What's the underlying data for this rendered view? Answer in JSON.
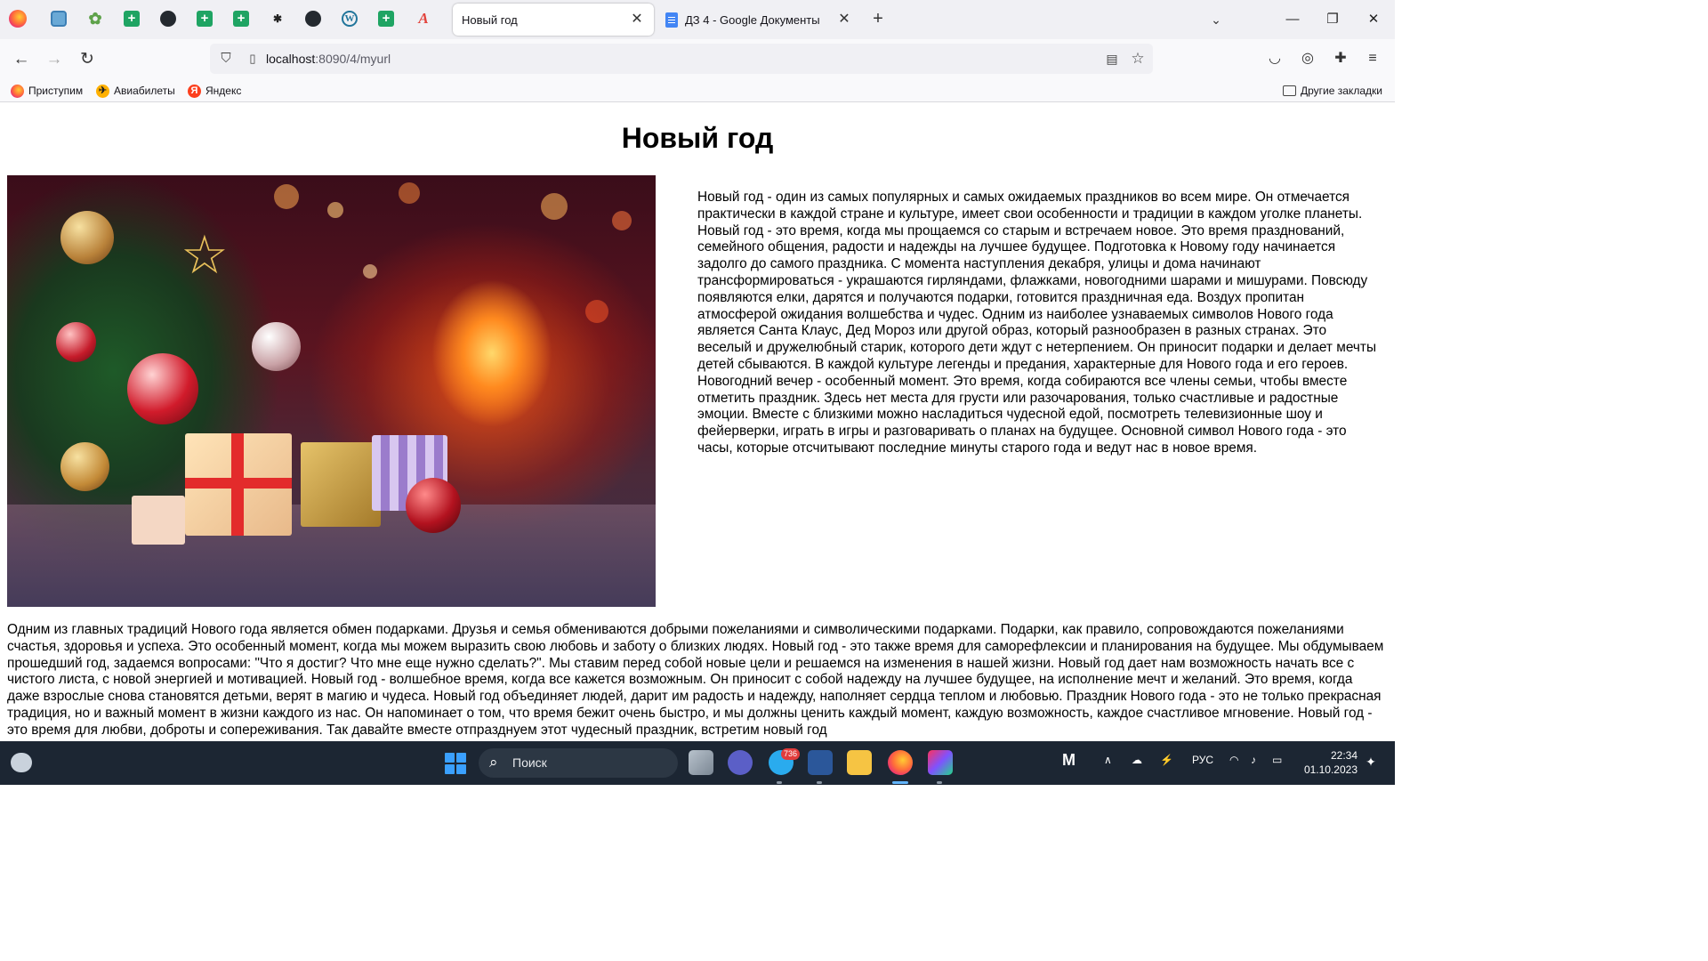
{
  "browser": {
    "tabs": [
      {
        "title": "Новый год",
        "active": true
      },
      {
        "title": "ДЗ 4 - Google Документы",
        "active": false
      }
    ],
    "address": {
      "host": "localhost",
      "path": ":8090/4/myurl"
    },
    "bookmarks": [
      "Приступим",
      "Авиабилеты",
      "Яндекс"
    ],
    "other_bookmarks": "Другие закладки",
    "icons": {
      "back": "arrow-left-icon",
      "forward": "arrow-right-icon",
      "reload": "reload-icon",
      "shield": "tracking-protection-icon",
      "reader": "reader-view-icon",
      "star": "bookmark-star-icon",
      "pocket": "pocket-icon",
      "account": "account-icon",
      "extensions": "extensions-icon",
      "menu": "hamburger-menu-icon"
    }
  },
  "page": {
    "title": "Новый год",
    "paragraph_right": "Новый год - один из самых популярных и самых ожидаемых праздников во всем мире. Он отмечается практически в каждой стране и культуре, имеет свои особенности и традиции в каждом уголке планеты. Новый год - это время, когда мы прощаемся со старым и встречаем новое. Это время празднований, семейного общения, радости и надежды на лучшее будущее. Подготовка к Новому году начинается задолго до самого праздника. С момента наступления декабря, улицы и дома начинают трансформироваться - украшаются гирляндами, флажками, новогодними шарами и мишурами. Повсюду появляются елки, дарятся и получаются подарки, готовится праздничная еда. Воздух пропитан атмосферой ожидания волшебства и чудес. Одним из наиболее узнаваемых символов Нового года является Санта Клаус, Дед Мороз или другой образ, который разнообразен в разных странах. Это веселый и дружелюбный старик, которого дети ждут с нетерпением. Он приносит подарки и делает мечты детей сбываются. В каждой культуре легенды и предания, характерные для Нового года и его героев. Новогодний вечер - особенный момент. Это время, когда собираются все члены семьи, чтобы вместе отметить праздник. Здесь нет места для грусти или разочарования, только счастливые и радостные эмоции. Вместе с близкими можно насладиться чудесной едой, посмотреть телевизионные шоу и фейерверки, играть в игры и разговаривать о планах на будущее. Основной символ Нового года - это часы, которые отсчитывают последние минуты старого года и ведут нас в новое время.",
    "paragraph_bottom": "Одним из главных традиций Нового года является обмен подарками. Друзья и семья обмениваются добрыми пожеланиями и символическими подарками. Подарки, как правило, сопровождаются пожеланиями счастья, здоровья и успеха. Это особенный момент, когда мы можем выразить свою любовь и заботу о близких людях. Новый год - это также время для саморефлексии и планирования на будущее. Мы обдумываем прошедший год, задаемся вопросами: \"Что я достиг? Что мне еще нужно сделать?\". Мы ставим перед собой новые цели и решаемся на изменения в нашей жизни. Новый год дает нам возможность начать все с чистого листа, с новой энергией и мотивацией. Новый год - волшебное время, когда все кажется возможным. Он приносит с собой надежду на лучшее будущее, на исполнение мечт и желаний. Это время, когда даже взрослые снова становятся детьми, верят в магию и чудеса. Новый год объединяет людей, дарит им радость и надежду, наполняет сердца теплом и любовью. Праздник Нового года - это не только прекрасная традиция, но и важный момент в жизни каждого из нас. Он напоминает о том, что время бежит очень быстро, и мы должны ценить каждый момент, каждую возможность, каждое счастливое мгновение. Новый год - это время для любви, доброты и сопереживания. Так давайте вместе отпразднуем этот чудесный праздник, встретим новый год"
  },
  "taskbar": {
    "search_label": "Поиск",
    "telegram_badge": "736",
    "language": "РУС",
    "time": "22:34",
    "date": "01.10.2023",
    "accent_color": "#62b5ff"
  }
}
